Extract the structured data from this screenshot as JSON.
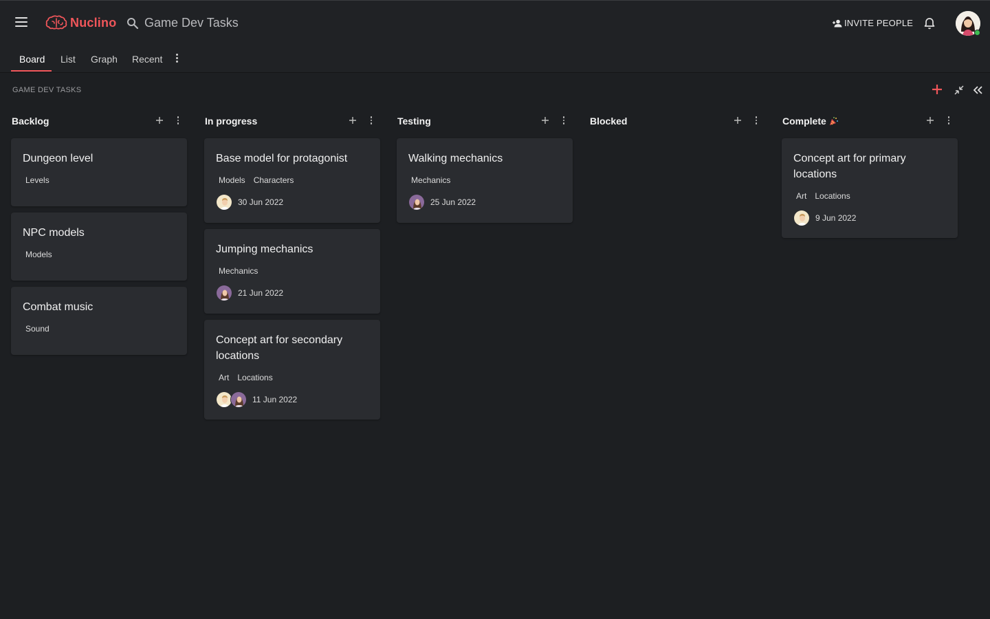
{
  "app": {
    "name": "Nuclino",
    "brand_color": "#f0565a"
  },
  "search": {
    "text": "Game Dev Tasks"
  },
  "header": {
    "invite_label": "INVITE PEOPLE"
  },
  "tabs": [
    {
      "label": "Board",
      "active": true
    },
    {
      "label": "List"
    },
    {
      "label": "Graph"
    },
    {
      "label": "Recent"
    }
  ],
  "board": {
    "title": "GAME DEV TASKS"
  },
  "columns": [
    {
      "title": "Backlog",
      "cards": [
        {
          "title": "Dungeon level",
          "tags": [
            "Levels"
          ]
        },
        {
          "title": "NPC models",
          "tags": [
            "Models"
          ]
        },
        {
          "title": "Combat music",
          "tags": [
            "Sound"
          ]
        }
      ]
    },
    {
      "title": "In progress",
      "cards": [
        {
          "title": "Base model for protagonist",
          "tags": [
            "Models",
            "Characters"
          ],
          "assignees": [
            "avatar-man"
          ],
          "date": "30 Jun 2022"
        },
        {
          "title": "Jumping mechanics",
          "tags": [
            "Mechanics"
          ],
          "assignees": [
            "avatar-woman"
          ],
          "date": "21 Jun 2022"
        },
        {
          "title": "Concept art for secondary locations",
          "tags": [
            "Art",
            "Locations"
          ],
          "assignees": [
            "avatar-man",
            "avatar-woman"
          ],
          "date": "11 Jun 2022"
        }
      ]
    },
    {
      "title": "Testing",
      "cards": [
        {
          "title": "Walking mechanics",
          "tags": [
            "Mechanics"
          ],
          "assignees": [
            "avatar-woman"
          ],
          "date": "25 Jun 2022"
        }
      ]
    },
    {
      "title": "Blocked",
      "cards": []
    },
    {
      "title": "Complete",
      "title_emoji": "party-popper-icon",
      "cards": [
        {
          "title": "Concept art for primary locations",
          "tags": [
            "Art",
            "Locations"
          ],
          "assignees": [
            "avatar-man"
          ],
          "date": "9 Jun 2022"
        }
      ]
    }
  ]
}
